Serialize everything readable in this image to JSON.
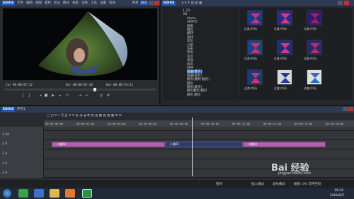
{
  "player": {
    "brand": "EDIUS",
    "menu": [
      "文件",
      "编辑",
      "视图",
      "素材",
      "标记",
      "模式",
      "采集",
      "渲染",
      "工具",
      "设置",
      "帮助"
    ],
    "mode": "PLR",
    "mode_alt": "REC",
    "timecode_in_label": "Cur",
    "timecode_in": "00:00:07;12",
    "timecode_out_label": "Dur",
    "timecode_out": "00:00:05:10",
    "timecode_dur_label": "Dur",
    "timecode_dur": "00:00:54:32"
  },
  "bin": {
    "brand": "EDIUS",
    "tree_items": [
      "1 2D",
      "3D",
      "Alpha",
      "SMPTE",
      "图案",
      "推拉",
      "翻转",
      "旋转",
      "双页",
      "分割",
      "方形",
      "单页",
      "双页",
      "发送",
      "四页",
      "时钟",
      "扭曲(翻页)",
      "扭曲(纸片)",
      "翻页(翻转 翻页)",
      "翻页",
      "翻页(翻页)",
      "翻页翻页 翻页",
      "翻页 翻页"
    ],
    "thumb_captions": [
      "过渡(中间)",
      "过渡(中间)",
      "过渡(中间)",
      "过渡(中间)",
      "过渡(中间)",
      "过渡(中间)",
      "过渡(中间)",
      "过渡(中间)",
      "过渡(中间)"
    ],
    "tabs": [
      "素材库",
      "特效",
      "序列",
      "源文件浏览"
    ]
  },
  "timeline": {
    "brand": "EDIUS",
    "sequence": "序列1",
    "ruler_ticks": [
      "00:00:00;00",
      "00:00:02;00",
      "00:00:04;00",
      "00:00:06;00",
      "00:00:08;00",
      "00:00:10;00",
      "00:00:12;00",
      "00:00:14;00",
      "00:00:16;00",
      "00:00:18;00"
    ],
    "playhead_tc": "00:00:07;12",
    "tracks": [
      "1 VA",
      "2 V",
      "1 A",
      "2 A",
      "3 A"
    ],
    "clips": [
      "人像02",
      "人像03",
      "人像04"
    ],
    "status_left": "暂停",
    "status_right": [
      "插入模式",
      "波纹模式",
      "磁盘: 0% 可用空间"
    ]
  },
  "taskbar": {
    "watermark": "Bai 经验",
    "watermark_sub": "jingyan.baidu.com",
    "time": "19:24",
    "date": "2016/4/27"
  }
}
